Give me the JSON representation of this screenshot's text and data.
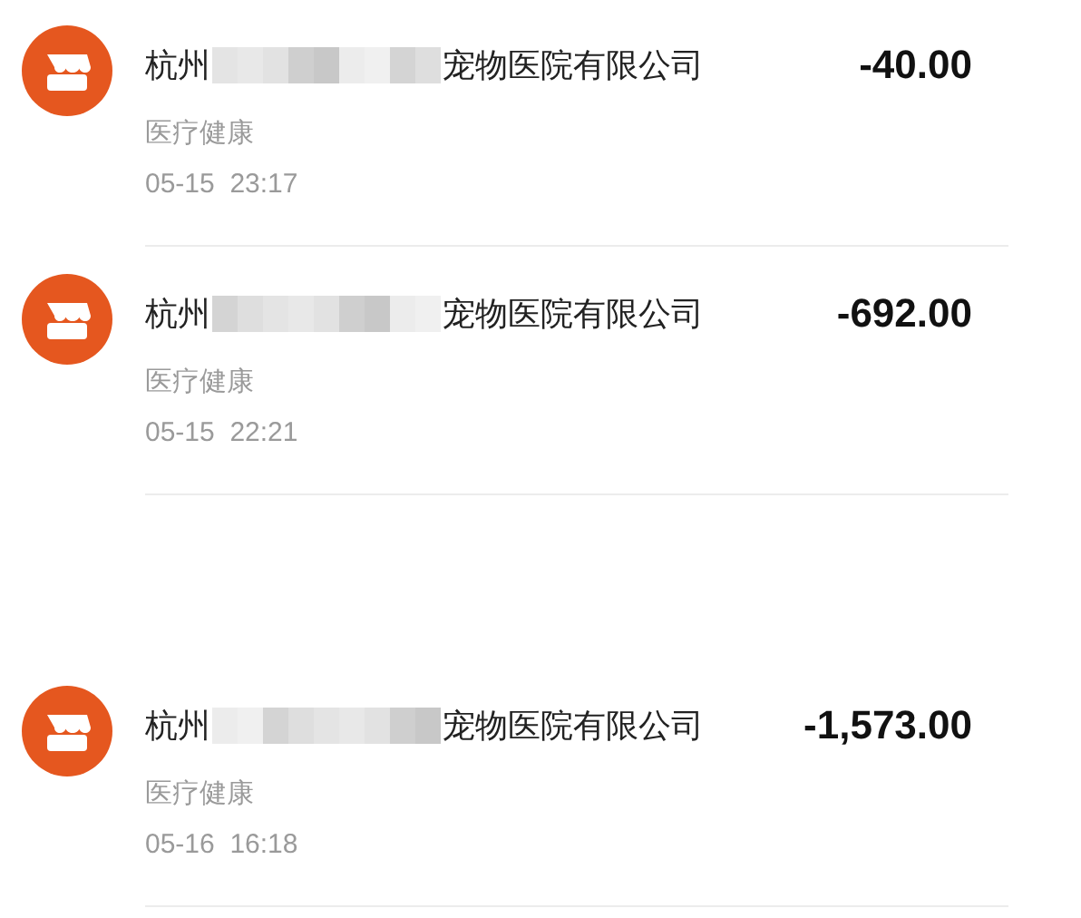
{
  "transactions": [
    {
      "name_start": "杭州",
      "redacted": true,
      "name_end": "宠物医院有限公司",
      "amount": "-40.00",
      "category": "医疗健康",
      "time": "05-15  23:17"
    },
    {
      "name_start": "杭州",
      "redacted": true,
      "name_end": "宠物医院有限公司",
      "amount": "-692.00",
      "category": "医疗健康",
      "time": "05-15  22:21"
    },
    {
      "name_start": "杭州",
      "redacted": true,
      "name_end": "宠物医院有限公司",
      "amount": "-1,573.00",
      "category": "医疗健康",
      "time": "05-16  16:18"
    }
  ]
}
